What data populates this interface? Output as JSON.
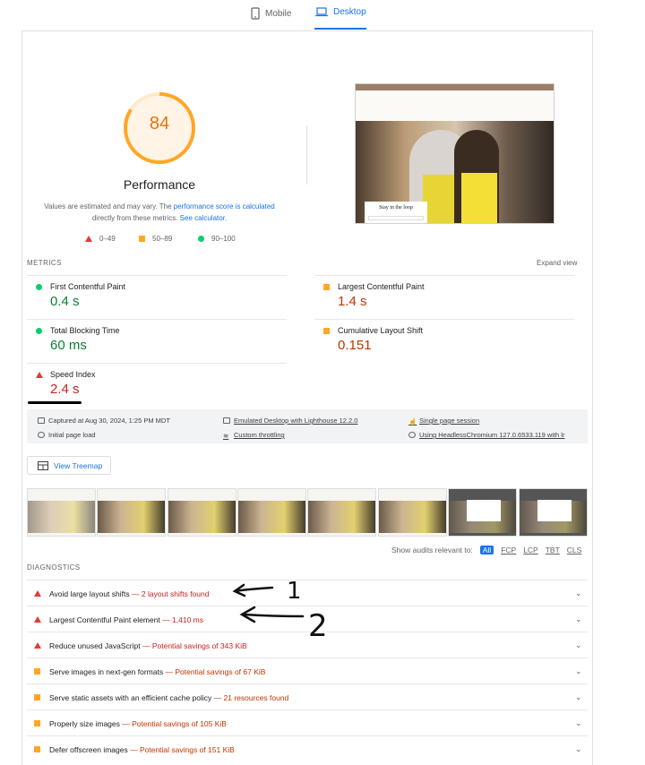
{
  "tabs": {
    "mobile": "Mobile",
    "desktop": "Desktop"
  },
  "score": {
    "value": "84",
    "fraction": 0.84,
    "label": "Performance",
    "note_prefix": "Values are estimated and may vary. The ",
    "note_link1": "performance score is calculated",
    "note_mid": " directly from these metrics. ",
    "note_link2": "See calculator."
  },
  "legend": {
    "bad": "0–49",
    "average": "50–89",
    "good": "90–100"
  },
  "preview": {
    "popup_title": "Stay in the loop"
  },
  "metrics_section": {
    "label": "METRICS",
    "expand": "Expand view"
  },
  "metrics": [
    {
      "name": "First Contentful Paint",
      "value": "0.4 s",
      "rating": "good"
    },
    {
      "name": "Largest Contentful Paint",
      "value": "1.4 s",
      "rating": "average"
    },
    {
      "name": "Total Blocking Time",
      "value": "60 ms",
      "rating": "good"
    },
    {
      "name": "Cumulative Layout Shift",
      "value": "0.151",
      "rating": "average"
    },
    {
      "name": "Speed Index",
      "value": "2.4 s",
      "rating": "bad"
    }
  ],
  "run_info": {
    "captured": "Captured at Aug 30, 2024, 1:25 PM MDT",
    "page_load": "Initial page load",
    "emulated": "Emulated Desktop with Lighthouse 12.2.0",
    "throttling": "Custom throttling",
    "session": "Single page session",
    "browser": "Using HeadlessChromium 127.0.6533.119 with lr"
  },
  "treemap": {
    "label": "View Treemap"
  },
  "audit_filter": {
    "label": "Show audits relevant to:",
    "options": [
      "All",
      "FCP",
      "LCP",
      "TBT",
      "CLS"
    ]
  },
  "diagnostics_section": {
    "label": "DIAGNOSTICS"
  },
  "diagnostics": [
    {
      "title": "Avoid large layout shifts",
      "detail": "2 layout shifts found",
      "severity": "bad"
    },
    {
      "title": "Largest Contentful Paint element",
      "detail": "1,410 ms",
      "severity": "bad"
    },
    {
      "title": "Reduce unused JavaScript",
      "detail": "Potential savings of 343 KiB",
      "severity": "bad"
    },
    {
      "title": "Serve images in next-gen formats",
      "detail": "Potential savings of 67 KiB",
      "severity": "average"
    },
    {
      "title": "Serve static assets with an efficient cache policy",
      "detail": "21 resources found",
      "severity": "average"
    },
    {
      "title": "Properly size images",
      "detail": "Potential savings of 105 KiB",
      "severity": "average"
    },
    {
      "title": "Defer offscreen images",
      "detail": "Potential savings of 151 KiB",
      "severity": "average"
    }
  ],
  "annotations": {
    "one": "1",
    "two": "2"
  },
  "colors": {
    "accent": "#1a73e8",
    "good": "#0cce6b",
    "average": "#ffa726",
    "bad": "#e53935",
    "gauge": "#ffa726"
  }
}
